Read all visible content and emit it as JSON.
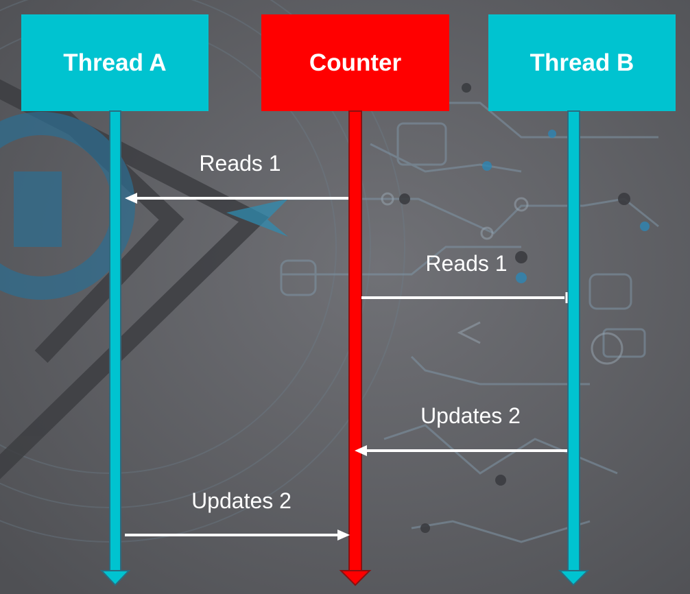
{
  "colors": {
    "background": "#5a5b5f",
    "thread": "#00c3d0",
    "counter": "#ff0000",
    "arrow": "#ffffff"
  },
  "participants": [
    {
      "id": "thread-a",
      "label": "Thread A",
      "color": "#00c3d0"
    },
    {
      "id": "counter",
      "label": "Counter",
      "color": "#ff0000"
    },
    {
      "id": "thread-b",
      "label": "Thread B",
      "color": "#00c3d0"
    }
  ],
  "messages": [
    {
      "label": "Reads 1",
      "from": "counter",
      "to": "thread-a"
    },
    {
      "label": "Reads 1",
      "from": "counter",
      "to": "thread-b"
    },
    {
      "label": "Updates 2",
      "from": "thread-b",
      "to": "counter"
    },
    {
      "label": "Updates 2",
      "from": "thread-a",
      "to": "counter"
    }
  ]
}
